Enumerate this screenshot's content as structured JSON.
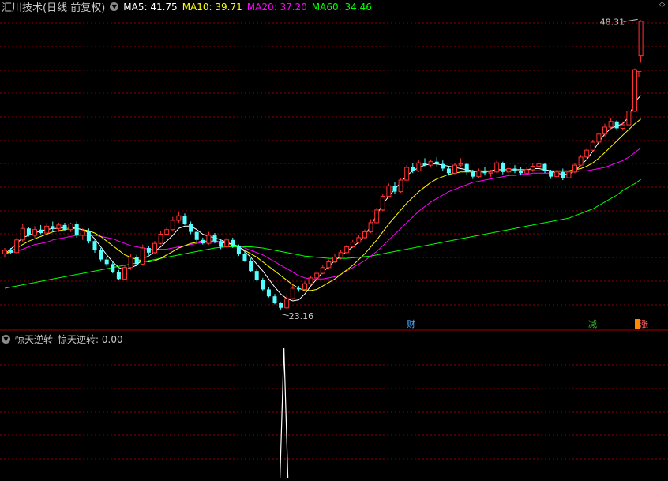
{
  "main_header": {
    "title": "汇川技术(日线 前复权)",
    "ma": [
      {
        "label": "MA5: 41.75",
        "color": "#ffffff"
      },
      {
        "label": "MA10: 39.71",
        "color": "#ffff00"
      },
      {
        "label": "MA20: 37.20",
        "color": "#ff00ff"
      },
      {
        "label": "MA60: 34.46",
        "color": "#00ff00"
      }
    ]
  },
  "sub_header": {
    "title": "惊天逆转",
    "value_label": "惊天逆转: 0.00"
  },
  "markers": {
    "high_label": "48.31",
    "low_label": "23.16",
    "event_cai": "财",
    "event_jian": "减",
    "event_zhang": "涨"
  },
  "colors": {
    "up": "#ff3232",
    "down": "#54ffff",
    "ma5": "#ffffff",
    "ma10": "#ffff00",
    "ma20": "#ff00ff",
    "ma60": "#00ff00",
    "grid": "#8b0000",
    "text": "#c8c8c8"
  },
  "chart_data": {
    "type": "candlestick",
    "panels": [
      "price",
      "惊天逆转"
    ],
    "price_range": [
      21.5,
      49.5
    ],
    "indicator_range": [
      0,
      1
    ],
    "bars": [
      [
        28.0,
        28.5,
        27.7,
        28.3
      ],
      [
        28.3,
        28.5,
        28.0,
        28.1
      ],
      [
        28.1,
        29.4,
        28.0,
        29.2
      ],
      [
        29.2,
        30.6,
        29.0,
        30.2
      ],
      [
        30.2,
        30.3,
        29.5,
        29.6
      ],
      [
        29.6,
        30.4,
        29.4,
        30.1
      ],
      [
        30.1,
        30.5,
        29.7,
        29.8
      ],
      [
        29.8,
        30.7,
        29.7,
        30.4
      ],
      [
        30.4,
        30.8,
        30.0,
        30.2
      ],
      [
        30.2,
        30.7,
        29.9,
        30.5
      ],
      [
        30.5,
        30.7,
        30.0,
        30.1
      ],
      [
        30.1,
        30.7,
        29.9,
        30.6
      ],
      [
        30.6,
        30.8,
        29.4,
        29.6
      ],
      [
        29.6,
        30.2,
        29.2,
        30.0
      ],
      [
        30.0,
        30.2,
        28.9,
        29.1
      ],
      [
        29.1,
        29.3,
        28.1,
        28.3
      ],
      [
        28.3,
        28.5,
        27.3,
        27.5
      ],
      [
        27.5,
        27.7,
        26.9,
        27.1
      ],
      [
        27.1,
        27.3,
        26.3,
        26.4
      ],
      [
        26.4,
        26.6,
        25.7,
        25.8
      ],
      [
        25.8,
        27.0,
        25.7,
        26.8
      ],
      [
        26.8,
        28.0,
        26.6,
        27.7
      ],
      [
        27.7,
        27.9,
        26.9,
        27.1
      ],
      [
        27.1,
        28.8,
        27.0,
        28.5
      ],
      [
        28.5,
        28.7,
        27.9,
        28.1
      ],
      [
        28.1,
        29.1,
        28.0,
        28.9
      ],
      [
        28.9,
        30.0,
        28.8,
        29.7
      ],
      [
        29.7,
        30.3,
        29.6,
        30.1
      ],
      [
        30.1,
        31.2,
        30.0,
        30.9
      ],
      [
        30.9,
        31.6,
        30.7,
        31.3
      ],
      [
        31.3,
        31.5,
        30.5,
        30.6
      ],
      [
        30.6,
        30.8,
        29.7,
        29.9
      ],
      [
        29.9,
        30.0,
        29.0,
        29.2
      ],
      [
        29.2,
        29.4,
        28.8,
        28.9
      ],
      [
        28.9,
        29.9,
        28.8,
        29.6
      ],
      [
        29.6,
        29.8,
        28.9,
        29.1
      ],
      [
        29.1,
        29.3,
        28.4,
        28.6
      ],
      [
        28.6,
        29.4,
        28.5,
        29.2
      ],
      [
        29.2,
        29.4,
        28.5,
        28.7
      ],
      [
        28.7,
        28.8,
        27.8,
        28.0
      ],
      [
        28.0,
        28.2,
        27.3,
        27.4
      ],
      [
        27.4,
        27.6,
        26.4,
        26.5
      ],
      [
        26.5,
        26.7,
        25.6,
        25.7
      ],
      [
        25.7,
        25.9,
        24.8,
        24.9
      ],
      [
        24.9,
        25.1,
        24.2,
        24.3
      ],
      [
        24.3,
        24.5,
        23.6,
        23.7
      ],
      [
        23.7,
        23.8,
        23.16,
        23.3
      ],
      [
        23.3,
        24.4,
        23.2,
        24.1
      ],
      [
        24.1,
        25.3,
        24.0,
        25.0
      ],
      [
        25.0,
        25.2,
        24.7,
        24.9
      ],
      [
        24.9,
        25.6,
        24.8,
        25.4
      ],
      [
        25.4,
        26.1,
        25.3,
        25.9
      ],
      [
        25.9,
        26.5,
        25.7,
        26.3
      ],
      [
        26.3,
        27.0,
        26.2,
        26.8
      ],
      [
        26.8,
        27.5,
        26.7,
        27.3
      ],
      [
        27.3,
        28.0,
        27.2,
        27.7
      ],
      [
        27.7,
        28.3,
        27.5,
        28.1
      ],
      [
        28.1,
        28.8,
        28.0,
        28.6
      ],
      [
        28.6,
        29.2,
        28.5,
        29.0
      ],
      [
        29.0,
        29.6,
        28.9,
        29.4
      ],
      [
        29.4,
        30.1,
        29.3,
        29.9
      ],
      [
        29.9,
        31.0,
        29.8,
        30.7
      ],
      [
        30.7,
        32.0,
        30.6,
        31.8
      ],
      [
        31.8,
        33.2,
        31.7,
        33.0
      ],
      [
        33.0,
        34.1,
        32.9,
        33.9
      ],
      [
        33.9,
        34.2,
        33.2,
        33.4
      ],
      [
        33.4,
        34.6,
        33.3,
        34.4
      ],
      [
        34.4,
        35.7,
        34.3,
        35.5
      ],
      [
        35.5,
        35.9,
        35.0,
        35.2
      ],
      [
        35.2,
        36.1,
        35.1,
        35.9
      ],
      [
        35.9,
        36.3,
        35.6,
        35.7
      ],
      [
        35.7,
        36.2,
        35.5,
        36.0
      ],
      [
        36.0,
        36.4,
        35.6,
        35.8
      ],
      [
        35.8,
        36.1,
        35.2,
        35.4
      ],
      [
        35.4,
        35.6,
        34.8,
        35.0
      ],
      [
        35.0,
        35.9,
        34.9,
        35.7
      ],
      [
        35.7,
        36.3,
        35.5,
        35.8
      ],
      [
        35.8,
        35.9,
        34.9,
        35.1
      ],
      [
        35.1,
        35.3,
        34.5,
        34.7
      ],
      [
        34.7,
        35.4,
        34.6,
        35.2
      ],
      [
        35.2,
        35.5,
        34.8,
        35.0
      ],
      [
        35.0,
        35.3,
        34.7,
        35.1
      ],
      [
        35.1,
        36.1,
        35.0,
        35.9
      ],
      [
        35.9,
        36.0,
        34.9,
        35.1
      ],
      [
        35.1,
        35.6,
        34.9,
        35.4
      ],
      [
        35.4,
        35.7,
        35.0,
        35.2
      ],
      [
        35.2,
        35.5,
        34.8,
        35.0
      ],
      [
        35.0,
        35.5,
        34.9,
        35.3
      ],
      [
        35.3,
        35.9,
        35.1,
        35.6
      ],
      [
        35.6,
        36.2,
        35.5,
        35.8
      ],
      [
        35.8,
        35.9,
        35.0,
        35.2
      ],
      [
        35.2,
        35.3,
        34.5,
        34.7
      ],
      [
        34.7,
        35.3,
        34.6,
        35.1
      ],
      [
        35.1,
        35.4,
        34.4,
        34.6
      ],
      [
        34.6,
        35.3,
        34.5,
        35.1
      ],
      [
        35.1,
        35.9,
        35.0,
        35.7
      ],
      [
        35.7,
        36.6,
        35.6,
        36.4
      ],
      [
        36.4,
        37.2,
        36.3,
        37.0
      ],
      [
        37.0,
        37.9,
        36.9,
        37.7
      ],
      [
        37.7,
        38.6,
        37.6,
        38.4
      ],
      [
        38.4,
        39.3,
        38.2,
        39.0
      ],
      [
        39.0,
        39.8,
        38.8,
        39.5
      ],
      [
        39.5,
        39.6,
        38.7,
        38.9
      ],
      [
        38.9,
        39.5,
        38.7,
        39.2
      ],
      [
        39.2,
        40.7,
        39.1,
        40.4
      ],
      [
        40.4,
        44.1,
        40.3,
        44.0
      ],
      [
        45.2,
        48.31,
        44.6,
        48.2
      ]
    ],
    "ma5": [
      28.0,
      28.4,
      28.9,
      29.4,
      29.6,
      29.8,
      30.0,
      30.1,
      30.2,
      30.2,
      30.3,
      30.3,
      30.2,
      30.1,
      29.8,
      29.3,
      28.6,
      27.9,
      27.3,
      26.8,
      26.6,
      26.8,
      27.0,
      27.6,
      27.8,
      28.2,
      28.6,
      29.1,
      29.6,
      30.2,
      30.4,
      30.4,
      30.1,
      29.7,
      29.5,
      29.4,
      29.2,
      29.0,
      28.8,
      28.6,
      28.2,
      27.7,
      27.1,
      26.5,
      25.8,
      25.1,
      24.5,
      24.1,
      23.9,
      24.0,
      24.5,
      25.2,
      25.8,
      26.4,
      26.9,
      27.4,
      27.8,
      28.2,
      28.6,
      29.0,
      29.6,
      30.4,
      31.4,
      32.3,
      33.0,
      33.6,
      34.2,
      34.8,
      35.2,
      35.5,
      35.7,
      35.8,
      35.8,
      35.7,
      35.6,
      35.5,
      35.4,
      35.3,
      35.2,
      35.1,
      35.1,
      35.2,
      35.3,
      35.3,
      35.3,
      35.3,
      35.3,
      35.3,
      35.4,
      35.4,
      35.3,
      35.2,
      35.0,
      34.9,
      34.9,
      35.2,
      35.7,
      36.2,
      36.9,
      37.7,
      38.4,
      38.9,
      39.1,
      39.3,
      39.9,
      41.2,
      41.75
    ],
    "ma10": [
      28.0,
      28.2,
      28.5,
      28.8,
      29.1,
      29.3,
      29.5,
      29.7,
      29.9,
      30.0,
      30.1,
      30.2,
      30.2,
      30.1,
      30.0,
      29.8,
      29.5,
      29.1,
      28.7,
      28.3,
      27.9,
      27.7,
      27.5,
      27.4,
      27.3,
      27.4,
      27.6,
      27.9,
      28.2,
      28.5,
      28.7,
      28.9,
      29.0,
      29.1,
      29.1,
      29.1,
      29.0,
      28.9,
      28.8,
      28.6,
      28.3,
      28.0,
      27.7,
      27.3,
      26.9,
      26.5,
      26.1,
      25.7,
      25.3,
      25.0,
      24.8,
      24.8,
      24.9,
      25.2,
      25.5,
      25.8,
      26.2,
      26.6,
      27.0,
      27.5,
      28.0,
      28.6,
      29.2,
      29.9,
      30.6,
      31.2,
      31.8,
      32.4,
      32.9,
      33.4,
      33.8,
      34.2,
      34.5,
      34.7,
      34.9,
      35.0,
      35.1,
      35.1,
      35.1,
      35.2,
      35.2,
      35.2,
      35.2,
      35.2,
      35.2,
      35.2,
      35.2,
      35.2,
      35.2,
      35.2,
      35.2,
      35.2,
      35.2,
      35.2,
      35.2,
      35.3,
      35.4,
      35.6,
      35.9,
      36.3,
      36.8,
      37.3,
      37.8,
      38.3,
      38.8,
      39.3,
      39.71
    ],
    "ma20": [
      28.0,
      28.1,
      28.2,
      28.4,
      28.6,
      28.8,
      28.9,
      29.0,
      29.2,
      29.3,
      29.4,
      29.5,
      29.6,
      29.6,
      29.6,
      29.6,
      29.5,
      29.4,
      29.3,
      29.1,
      28.9,
      28.7,
      28.6,
      28.5,
      28.4,
      28.4,
      28.4,
      28.4,
      28.5,
      28.6,
      28.7,
      28.8,
      28.9,
      29.0,
      29.0,
      29.0,
      29.0,
      28.9,
      28.8,
      28.7,
      28.5,
      28.3,
      28.1,
      27.9,
      27.6,
      27.3,
      27.0,
      26.7,
      26.4,
      26.1,
      25.9,
      25.8,
      25.8,
      25.8,
      25.9,
      26.0,
      26.2,
      26.5,
      26.8,
      27.1,
      27.4,
      27.8,
      28.2,
      28.7,
      29.2,
      29.7,
      30.2,
      30.7,
      31.2,
      31.7,
      32.1,
      32.5,
      32.8,
      33.1,
      33.4,
      33.6,
      33.8,
      34.0,
      34.2,
      34.3,
      34.4,
      34.5,
      34.6,
      34.7,
      34.8,
      34.8,
      34.9,
      34.9,
      35.0,
      35.0,
      35.0,
      35.0,
      35.1,
      35.1,
      35.1,
      35.1,
      35.2,
      35.2,
      35.3,
      35.4,
      35.5,
      35.7,
      35.9,
      36.1,
      36.4,
      36.8,
      37.2
    ],
    "ma60": [
      25.0,
      25.1,
      25.2,
      25.3,
      25.4,
      25.5,
      25.6,
      25.7,
      25.8,
      25.9,
      26.0,
      26.1,
      26.2,
      26.3,
      26.4,
      26.5,
      26.6,
      26.7,
      26.8,
      26.9,
      27.0,
      27.1,
      27.2,
      27.3,
      27.4,
      27.5,
      27.6,
      27.7,
      27.8,
      27.9,
      28.0,
      28.1,
      28.2,
      28.3,
      28.4,
      28.5,
      28.55,
      28.6,
      28.6,
      28.6,
      28.6,
      28.6,
      28.55,
      28.5,
      28.4,
      28.3,
      28.2,
      28.1,
      28.0,
      27.9,
      27.8,
      27.75,
      27.7,
      27.65,
      27.6,
      27.6,
      27.6,
      27.6,
      27.65,
      27.7,
      27.75,
      27.8,
      27.9,
      28.0,
      28.1,
      28.2,
      28.3,
      28.4,
      28.5,
      28.6,
      28.7,
      28.8,
      28.9,
      29.0,
      29.1,
      29.2,
      29.3,
      29.4,
      29.5,
      29.6,
      29.7,
      29.8,
      29.9,
      30.0,
      30.1,
      30.2,
      30.3,
      30.4,
      30.5,
      30.6,
      30.7,
      30.8,
      30.9,
      31.0,
      31.1,
      31.3,
      31.5,
      31.7,
      31.9,
      32.2,
      32.5,
      32.8,
      33.1,
      33.5,
      33.8,
      34.1,
      34.46
    ],
    "signal": {
      "index": 46,
      "value": 1
    }
  }
}
